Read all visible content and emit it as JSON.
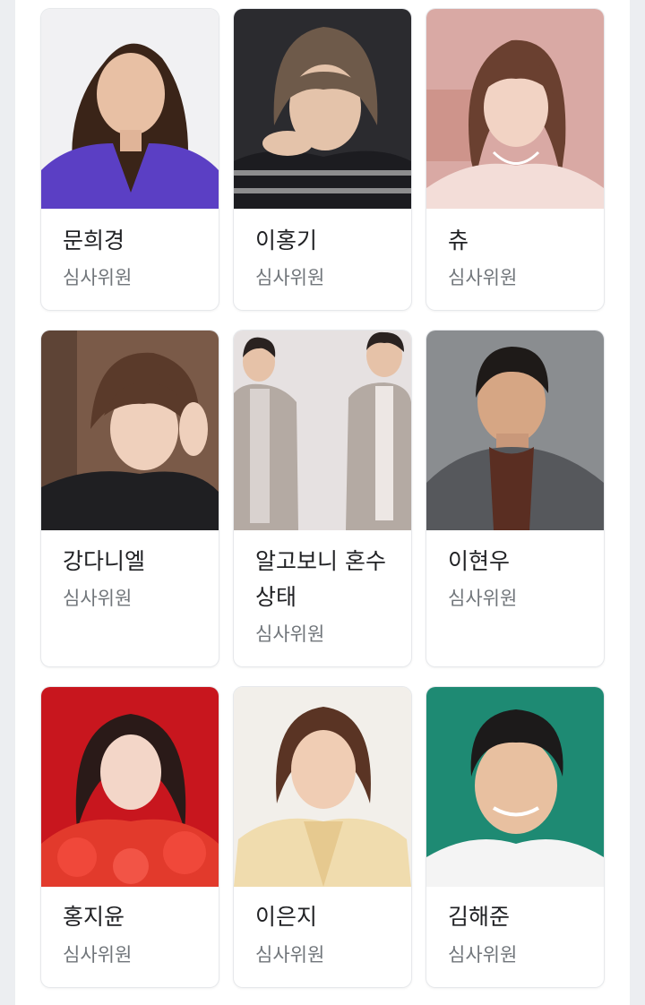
{
  "cards": [
    {
      "name": "문희경",
      "role": "심사위원",
      "bg": "#f1f1f3",
      "accent": "#5b3fc4",
      "hair": "#3a2418"
    },
    {
      "name": "이홍기",
      "role": "심사위원",
      "bg": "#2b2b2f",
      "accent": "#1c1c20",
      "hair": "#6e5a4a"
    },
    {
      "name": "츄",
      "role": "심사위원",
      "bg": "#d9a9a4",
      "accent": "#f3ddd8",
      "hair": "#6a4030"
    },
    {
      "name": "강다니엘",
      "role": "심사위원",
      "bg": "#7a5a48",
      "accent": "#1f1f22",
      "hair": "#5a3a2a"
    },
    {
      "name": "알고보니 혼수상태",
      "role": "심사위원",
      "bg": "#e6e1e1",
      "accent": "#b4aaa3",
      "hair": "#2a2220"
    },
    {
      "name": "이현우",
      "role": "심사위원",
      "bg": "#8a8d90",
      "accent": "#56585c",
      "hair": "#1e1a18"
    },
    {
      "name": "홍지윤",
      "role": "심사위원",
      "bg": "#c8161e",
      "accent": "#e23a2c",
      "hair": "#2a1a18"
    },
    {
      "name": "이은지",
      "role": "심사위원",
      "bg": "#f2efea",
      "accent": "#f0dcae",
      "hair": "#5a3424"
    },
    {
      "name": "김해준",
      "role": "심사위원",
      "bg": "#1e8a73",
      "accent": "#f4f4f4",
      "hair": "#1c1a1a"
    }
  ]
}
